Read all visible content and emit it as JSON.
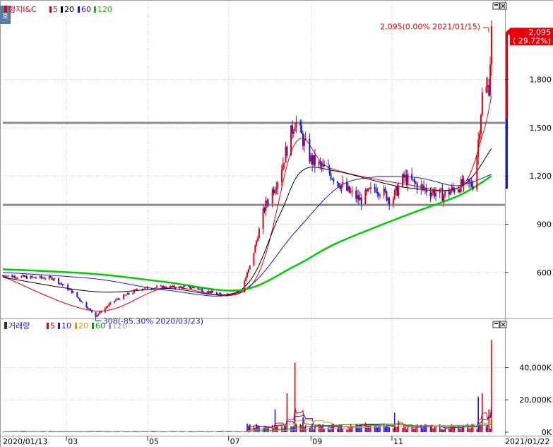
{
  "chart_data": [
    {
      "type": "candlestick",
      "title": "형지I&C",
      "legend": [
        {
          "name": "5",
          "color": "#e8000b"
        },
        {
          "name": "20",
          "color": "#000000"
        },
        {
          "name": "60",
          "color": "#1a1ad6"
        },
        {
          "name": "120",
          "color": "#00cc00"
        }
      ],
      "x_tick_labels": [
        "2020/01/13",
        "03",
        "05",
        "07",
        "09",
        "11",
        "2021/01/22"
      ],
      "x_ticks": [
        "2020-01-13",
        "2020-03-01",
        "2020-05-01",
        "2020-07-01",
        "2020-09-01",
        "2020-11-01",
        "2021-01-22"
      ],
      "y_tick_labels": [
        "600",
        "900",
        "1,200",
        "1,500",
        "1,800"
      ],
      "ylim": [
        340,
        2180
      ],
      "price_label": {
        "value": "2,095",
        "change": "( 29.72%)"
      },
      "annotations": [
        {
          "text": "2,095(0.00% 2021/01/15)",
          "date": "2021-01-15",
          "value": 2095
        },
        {
          "text": "308(-85.30% 2020/03/23)",
          "date": "2020-03-23",
          "value": 308
        }
      ],
      "horizontal_lines": [
        1530,
        1020
      ],
      "price_path": [
        [
          "2020-01-13",
          580
        ],
        [
          "2020-02-01",
          570
        ],
        [
          "2020-02-20",
          565
        ],
        [
          "2020-03-05",
          480
        ],
        [
          "2020-03-23",
          330
        ],
        [
          "2020-04-05",
          420
        ],
        [
          "2020-04-25",
          500
        ],
        [
          "2020-05-15",
          510
        ],
        [
          "2020-06-05",
          505
        ],
        [
          "2020-06-25",
          460
        ],
        [
          "2020-07-10",
          480
        ],
        [
          "2020-07-18",
          660
        ],
        [
          "2020-07-28",
          1000
        ],
        [
          "2020-08-08",
          1200
        ],
        [
          "2020-08-20",
          1550
        ],
        [
          "2020-09-01",
          1300
        ],
        [
          "2020-09-15",
          1220
        ],
        [
          "2020-09-28",
          1110
        ],
        [
          "2020-10-08",
          1050
        ],
        [
          "2020-10-20",
          1130
        ],
        [
          "2020-11-01",
          1050
        ],
        [
          "2020-11-10",
          1190
        ],
        [
          "2020-11-25",
          1120
        ],
        [
          "2020-12-10",
          1080
        ],
        [
          "2020-12-22",
          1140
        ],
        [
          "2021-01-02",
          1150
        ],
        [
          "2021-01-08",
          1700
        ],
        [
          "2021-01-13",
          1760
        ],
        [
          "2021-01-15",
          2095
        ]
      ],
      "ma": {
        "5": [
          [
            "2020-01-13",
            575
          ],
          [
            "2020-03-23",
            360
          ],
          [
            "2020-05-15",
            505
          ],
          [
            "2020-07-18",
            520
          ],
          [
            "2020-08-20",
            1400
          ],
          [
            "2020-09-15",
            1250
          ],
          [
            "2020-11-10",
            1150
          ],
          [
            "2020-12-22",
            1130
          ],
          [
            "2021-01-08",
            1450
          ],
          [
            "2021-01-15",
            1700
          ]
        ],
        "20": [
          [
            "2020-01-13",
            570
          ],
          [
            "2020-03-23",
            480
          ],
          [
            "2020-05-15",
            500
          ],
          [
            "2020-07-10",
            490
          ],
          [
            "2020-08-08",
            950
          ],
          [
            "2020-08-25",
            1230
          ],
          [
            "2020-09-20",
            1230
          ],
          [
            "2020-11-10",
            1130
          ],
          [
            "2020-12-22",
            1130
          ],
          [
            "2021-01-15",
            1370
          ]
        ],
        "60": [
          [
            "2020-01-13",
            600
          ],
          [
            "2020-03-23",
            560
          ],
          [
            "2020-05-15",
            490
          ],
          [
            "2020-07-10",
            480
          ],
          [
            "2020-08-20",
            850
          ],
          [
            "2020-09-20",
            1120
          ],
          [
            "2020-10-15",
            1190
          ],
          [
            "2020-11-20",
            1190
          ],
          [
            "2020-12-20",
            1140
          ],
          [
            "2021-01-15",
            1210
          ]
        ],
        "120": [
          [
            "2020-01-13",
            620
          ],
          [
            "2020-03-23",
            590
          ],
          [
            "2020-05-15",
            540
          ],
          [
            "2020-07-10",
            490
          ],
          [
            "2020-08-20",
            640
          ],
          [
            "2020-09-20",
            780
          ],
          [
            "2020-11-10",
            950
          ],
          [
            "2020-12-22",
            1080
          ],
          [
            "2021-01-15",
            1200
          ]
        ]
      }
    },
    {
      "type": "bar",
      "title": "거래량",
      "legend": [
        {
          "name": "5",
          "color": "#e8000b"
        },
        {
          "name": "10",
          "color": "#1a1ad6"
        },
        {
          "name": "20",
          "color": "#e89800"
        },
        {
          "name": "60",
          "color": "#00a000"
        },
        {
          "name": "120",
          "color": "#a0a0a0"
        }
      ],
      "y_tick_labels": [
        "0K",
        "20,000K",
        "40,000K"
      ],
      "ylim": [
        0,
        62000
      ],
      "unit": "K",
      "volume_spikes": [
        [
          "2020-07-18",
          12000
        ],
        [
          "2020-07-25",
          9000
        ],
        [
          "2020-08-05",
          14000
        ],
        [
          "2020-08-14",
          24000
        ],
        [
          "2020-08-20",
          43000
        ],
        [
          "2020-08-26",
          9000
        ],
        [
          "2020-09-10",
          5000
        ],
        [
          "2020-10-12",
          6000
        ],
        [
          "2020-11-03",
          12000
        ],
        [
          "2020-11-06",
          7000
        ],
        [
          "2021-01-05",
          22000
        ],
        [
          "2021-01-08",
          24000
        ],
        [
          "2021-01-13",
          14000
        ],
        [
          "2021-01-15",
          57000
        ]
      ]
    }
  ]
}
